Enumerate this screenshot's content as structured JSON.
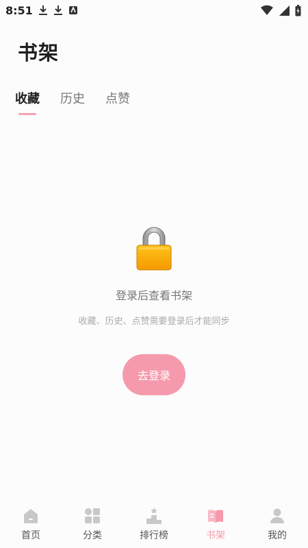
{
  "status_bar": {
    "time": "8:51",
    "left_icons": [
      "download-icon",
      "download-icon",
      "notification-icon"
    ],
    "right_icons": [
      "wifi-icon",
      "signal-icon",
      "battery-icon"
    ]
  },
  "header": {
    "title": "书架"
  },
  "tabs": [
    {
      "label": "收藏",
      "active": true
    },
    {
      "label": "历史",
      "active": false
    },
    {
      "label": "点赞",
      "active": false
    }
  ],
  "empty_state": {
    "icon": "lock-icon",
    "title": "登录后查看书架",
    "subtitle": "收藏、历史、点赞需要登录后才能同步",
    "button_label": "去登录"
  },
  "bottom_nav": {
    "items": [
      {
        "label": "首页",
        "icon": "home-icon",
        "active": false
      },
      {
        "label": "分类",
        "icon": "category-icon",
        "active": false
      },
      {
        "label": "排行榜",
        "icon": "ranking-icon",
        "active": false
      },
      {
        "label": "书架",
        "icon": "bookshelf-icon",
        "active": true
      },
      {
        "label": "我的",
        "icon": "profile-icon",
        "active": false
      }
    ]
  },
  "colors": {
    "accent": "#f59aac",
    "tab_indicator": "#f4a3b4",
    "background": "#fcfcfc"
  }
}
